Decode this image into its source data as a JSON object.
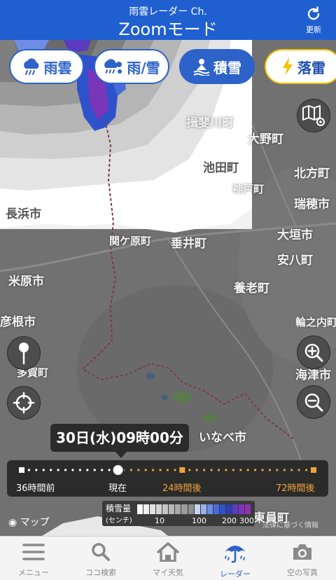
{
  "header": {
    "subtitle": "雨雲レーダー Ch.",
    "title": "Zoomモード",
    "refresh_label": "更新"
  },
  "modes": {
    "rain_cloud": "雨雲",
    "rain_snow": "雨/雪",
    "snow_depth": "積雪",
    "lightning": "落雷"
  },
  "places": {
    "settsu_kawa": "揖斐川町",
    "ono": "大野町",
    "ikeda": "池田町",
    "kitakata": "北方町",
    "godo": "神戸町",
    "mizuho": "瑞穂市",
    "nagahama": "長浜市",
    "sekigahara": "関ケ原町",
    "tarui": "垂井町",
    "ogaki": "大垣市",
    "anpachi": "安八町",
    "maibara": "米原市",
    "yoro": "養老町",
    "hikone": "彦根市",
    "wanouchi": "輪之内町",
    "kaizu": "海津市",
    "taga": "多賀町",
    "inabe": "いなべ市",
    "tomei": "東員町"
  },
  "time_bubble": "30日(水)09時00分",
  "timeline": {
    "label_past": "36時間前",
    "label_now": "現在",
    "label_24": "24時間後",
    "label_72": "72時間後",
    "current_fraction": 0.33
  },
  "legend": {
    "title": "積雪量",
    "unit": "(センチ)",
    "ticks": [
      "10",
      "100",
      "200",
      "300"
    ],
    "colors": [
      "#ffffff",
      "#f0f0f0",
      "#e2e2e2",
      "#d4d4d4",
      "#c6c6c6",
      "#b8b8b8",
      "#aaaaaa",
      "#9c9c9c",
      "#8e8e8e",
      "#c9d4f3",
      "#9db2ec",
      "#6f8de4",
      "#4a6cd8",
      "#2e52cc",
      "#2d3fb6",
      "#5b3bc0",
      "#7a36b8",
      "#9430b0"
    ]
  },
  "attribution": {
    "maps": "マップ",
    "legal": "法律に基づく情報"
  },
  "tabbar": {
    "menu": "メニュー",
    "search": "ココ検索",
    "my_weather": "マイ天気",
    "radar": "レーダー",
    "sky_photo": "空の写真"
  },
  "colors": {
    "accent": "#2d63c8",
    "header": "#1f5fd0",
    "orange": "#f0a33a",
    "lightning": "#f2c200"
  }
}
